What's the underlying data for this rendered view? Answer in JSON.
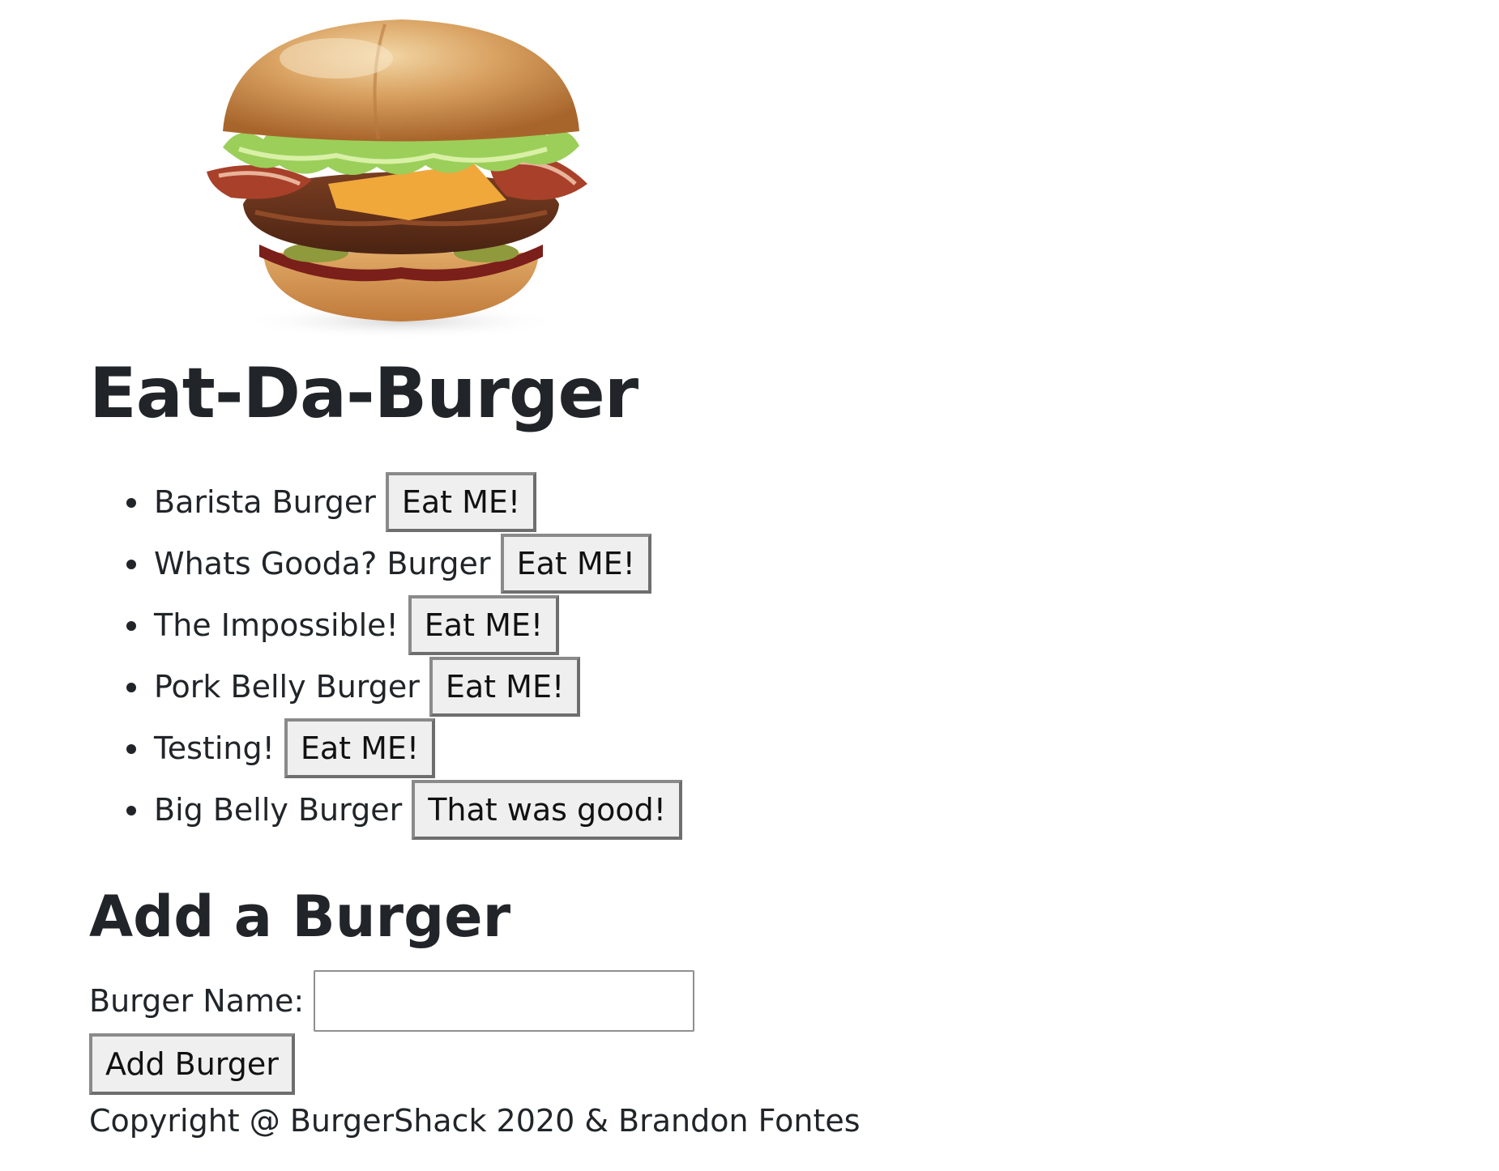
{
  "header": {
    "title": "Eat-Da-Burger"
  },
  "burgers": [
    {
      "name": "Barista Burger",
      "button_label": "Eat ME!"
    },
    {
      "name": "Whats Gooda? Burger",
      "button_label": "Eat ME!"
    },
    {
      "name": "The Impossible!",
      "button_label": "Eat ME!"
    },
    {
      "name": "Pork Belly Burger",
      "button_label": "Eat ME!"
    },
    {
      "name": "Testing!",
      "button_label": "Eat ME!"
    },
    {
      "name": "Big Belly Burger",
      "button_label": "That was good!"
    }
  ],
  "add_form": {
    "heading": "Add a Burger",
    "name_label": "Burger Name:",
    "name_value": "",
    "submit_label": "Add Burger"
  },
  "footer": {
    "copyright": "Copyright @ BurgerShack 2020 & Brandon Fontes"
  },
  "hero": {
    "icon": "burger-image"
  }
}
